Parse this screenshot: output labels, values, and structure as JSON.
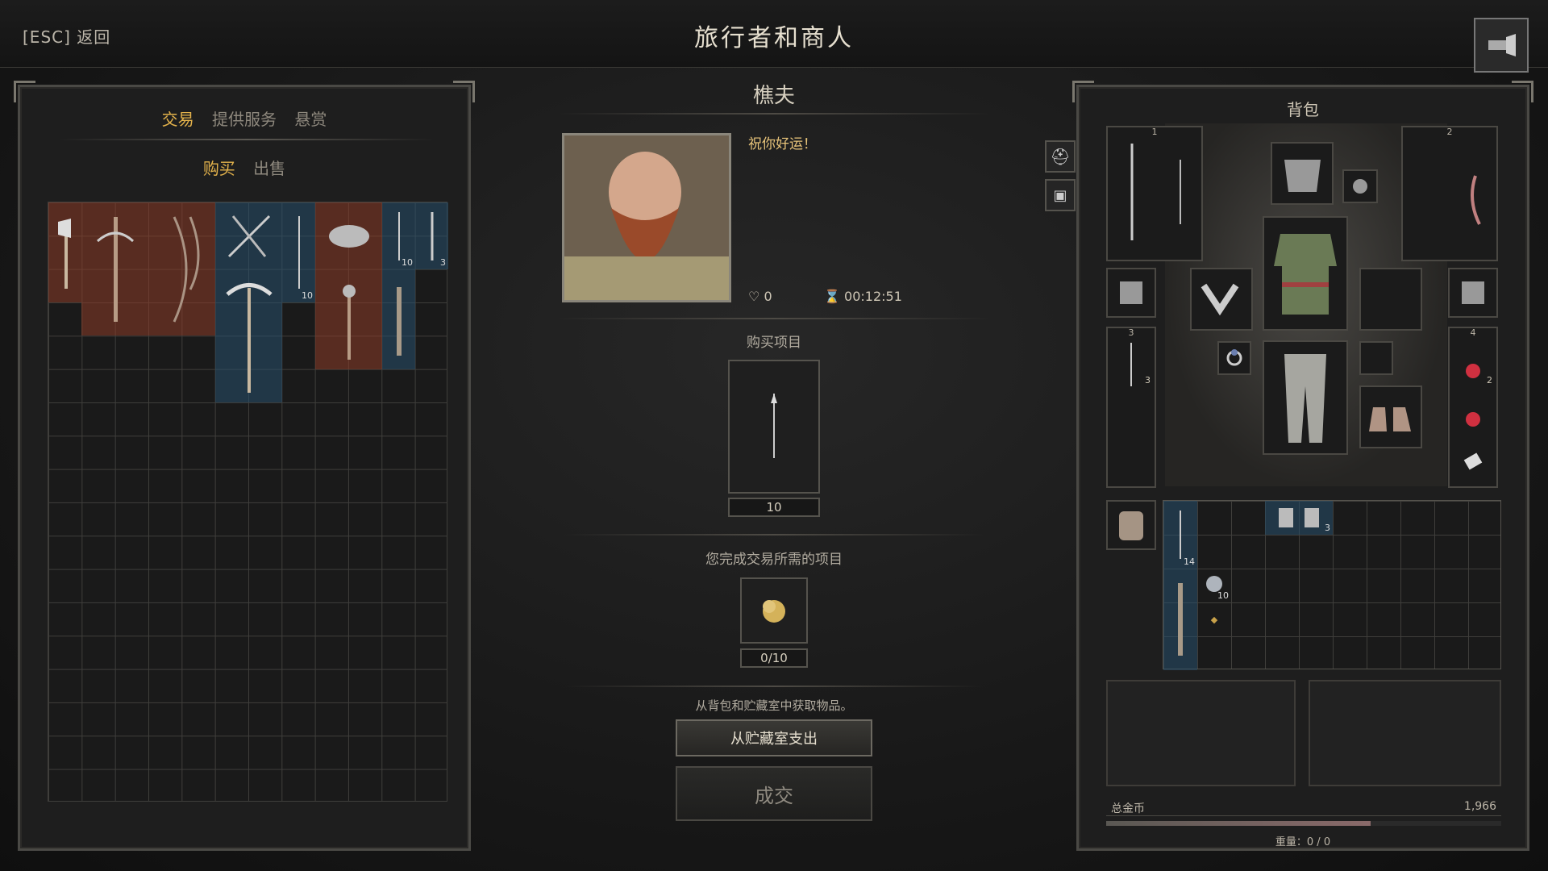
{
  "header": {
    "esc_label": "[ESC] 返回",
    "title": "旅行者和商人"
  },
  "left_panel": {
    "tabs": [
      "交易",
      "提供服务",
      "悬赏"
    ],
    "active_tab": 0,
    "subtabs": [
      "购买",
      "出售"
    ],
    "active_subtab": 0,
    "item_quantities": {
      "arrows_a": "10",
      "arrows_b": "10",
      "arrows_c": "3"
    }
  },
  "merchant": {
    "name": "樵夫",
    "greeting": "祝你好运！",
    "reputation": "0",
    "timer": "00:12:51",
    "buy_label": "购买项目",
    "buy_quantity": "10",
    "required_label": "您完成交易所需的项目",
    "required_progress": "0/10",
    "source_note": "从背包和贮藏室中获取物品。",
    "stash_button": "从贮藏室支出",
    "confirm_button": "成交"
  },
  "backpack": {
    "title": "背包",
    "slot_numbers": [
      "1",
      "2",
      "3",
      "4"
    ],
    "quiver_qty": "3",
    "potion_qty": "2",
    "bag_arrows_qty": "14",
    "mug_qty": "3",
    "coin_qty": "10",
    "gold_label": "总金币",
    "gold_value": "1,966",
    "gold_fill": 0.67,
    "weight_label": "重量：0 / 0"
  },
  "colors": {
    "accent": "#e3b24b",
    "red_slot": "#8c3c28",
    "blue_slot": "#28506e"
  }
}
